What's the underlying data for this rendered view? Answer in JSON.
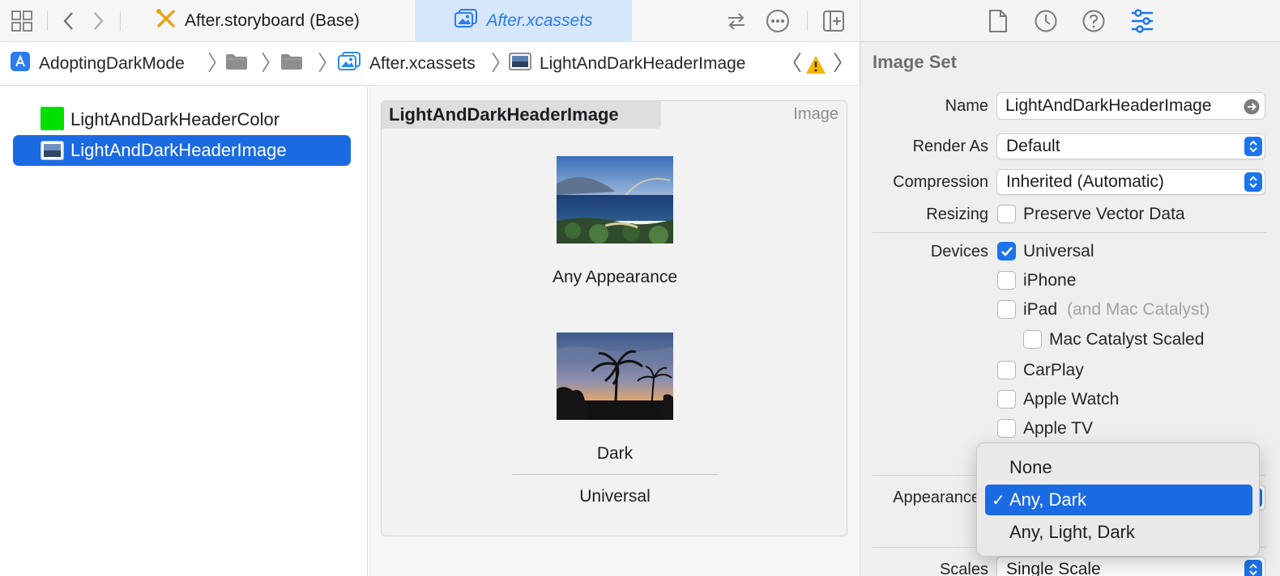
{
  "tabs": [
    {
      "label": "After.storyboard (Base)",
      "icon": "storyboard-icon"
    },
    {
      "label": "After.xcassets",
      "icon": "asset-catalog-icon",
      "active": true
    }
  ],
  "breadcrumb": {
    "project": "AdoptingDarkMode",
    "catalog": "After.xcassets",
    "item": "LightAndDarkHeaderImage"
  },
  "navigator": {
    "items": [
      {
        "label": "LightAndDarkHeaderColor",
        "icon": "color-set-icon",
        "selected": false
      },
      {
        "label": "LightAndDarkHeaderImage",
        "icon": "image-set-icon",
        "selected": true
      }
    ]
  },
  "editor": {
    "set_title": "LightAndDarkHeaderImage",
    "set_type": "Image",
    "slots": [
      {
        "label": "Any Appearance",
        "image": "ocean-rainbow-photo"
      },
      {
        "label": "Dark",
        "image": "palm-sunset-photo"
      }
    ],
    "group_label": "Universal"
  },
  "inspector": {
    "section_title": "Image Set",
    "name": {
      "label": "Name",
      "value": "LightAndDarkHeaderImage"
    },
    "render_as": {
      "label": "Render As",
      "value": "Default"
    },
    "compression": {
      "label": "Compression",
      "value": "Inherited (Automatic)"
    },
    "resizing": {
      "label": "Resizing",
      "option": "Preserve Vector Data",
      "checked": false
    },
    "devices": {
      "label": "Devices",
      "universal": {
        "label": "Universal",
        "checked": true
      },
      "iphone": {
        "label": "iPhone",
        "checked": false
      },
      "ipad": {
        "label": "iPad",
        "note": "(and Mac Catalyst)",
        "checked": false
      },
      "mac_catalyst_scaled": {
        "label": "Mac Catalyst Scaled",
        "checked": false
      },
      "carplay": {
        "label": "CarPlay",
        "checked": false
      },
      "apple_watch": {
        "label": "Apple Watch",
        "checked": false
      },
      "apple_tv": {
        "label": "Apple TV",
        "checked": false
      }
    },
    "appearance": {
      "label": "Appearance"
    },
    "scales": {
      "label": "Scales",
      "value": "Single Scale"
    }
  },
  "appearance_menu": {
    "options": [
      "None",
      "Any, Dark",
      "Any, Light, Dark"
    ],
    "selected": "Any, Dark",
    "checkmark": "✓"
  },
  "colors": {
    "accent": "#1a6ae2",
    "active_tab_bg": "#d6e6fb",
    "header_color_swatch": "#00e000",
    "warning": "#f5b400"
  }
}
